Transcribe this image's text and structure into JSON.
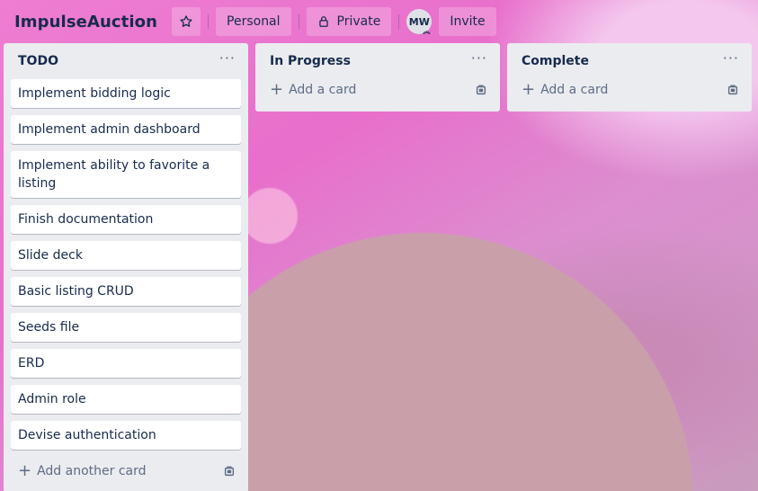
{
  "header": {
    "board_title": "ImpulseAuction",
    "star_icon": "star-icon",
    "workspace_label": "Personal",
    "visibility_label": "Private",
    "visibility_icon": "lock-icon",
    "avatar_initials": "MW",
    "invite_label": "Invite"
  },
  "lists": [
    {
      "title": "TODO",
      "cards": [
        "Implement bidding logic",
        "Implement admin dashboard",
        "Implement ability to favorite a listing",
        "Finish documentation",
        "Slide deck",
        "Basic listing CRUD",
        "Seeds file",
        "ERD",
        "Admin role",
        "Devise authentication"
      ],
      "add_label": "Add another card"
    },
    {
      "title": "In Progress",
      "cards": [],
      "add_label": "Add a card"
    },
    {
      "title": "Complete",
      "cards": [],
      "add_label": "Add a card"
    }
  ],
  "menu_glyph": "···"
}
